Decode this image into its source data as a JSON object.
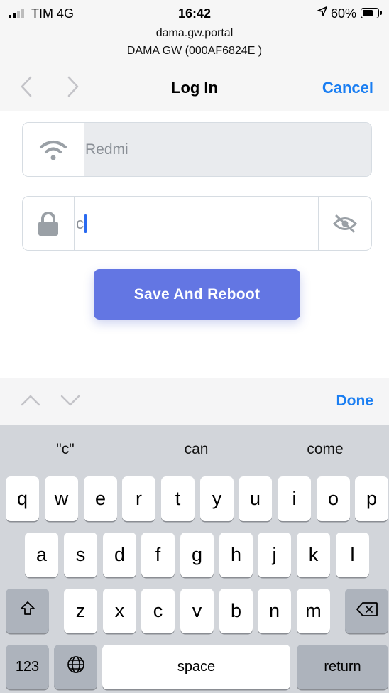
{
  "status_bar": {
    "carrier": "TIM  4G",
    "time": "16:42",
    "location_icon": "location-arrow-icon",
    "battery_percent": "60%",
    "battery_level": 0.6,
    "signal_bars_active": 2
  },
  "header": {
    "host": "dama.gw.portal",
    "subtitle": "DAMA GW (000AF6824E    )",
    "back_icon": "chevron-left-icon",
    "forward_icon": "chevron-right-icon",
    "title": "Log In",
    "cancel_label": "Cancel"
  },
  "form": {
    "ssid": {
      "icon": "wifi-icon",
      "value": "Redmi"
    },
    "password": {
      "icon": "lock-icon",
      "value": "c",
      "toggle_icon": "eye-slash-icon"
    },
    "submit_label": "Save And Reboot",
    "accent_color": "#6376e3"
  },
  "keyboard_accessory": {
    "prev_icon": "chevron-up-icon",
    "next_icon": "chevron-down-icon",
    "done_label": "Done"
  },
  "keyboard": {
    "suggestions": [
      "\"c\"",
      "can",
      "come"
    ],
    "row1": [
      "q",
      "w",
      "e",
      "r",
      "t",
      "y",
      "u",
      "i",
      "o",
      "p"
    ],
    "row2": [
      "a",
      "s",
      "d",
      "f",
      "g",
      "h",
      "j",
      "k",
      "l"
    ],
    "row3": [
      "z",
      "x",
      "c",
      "v",
      "b",
      "n",
      "m"
    ],
    "shift_icon": "shift-icon",
    "delete_icon": "backspace-icon",
    "numbers_label": "123",
    "globe_icon": "globe-icon",
    "space_label": "space",
    "return_label": "return"
  }
}
